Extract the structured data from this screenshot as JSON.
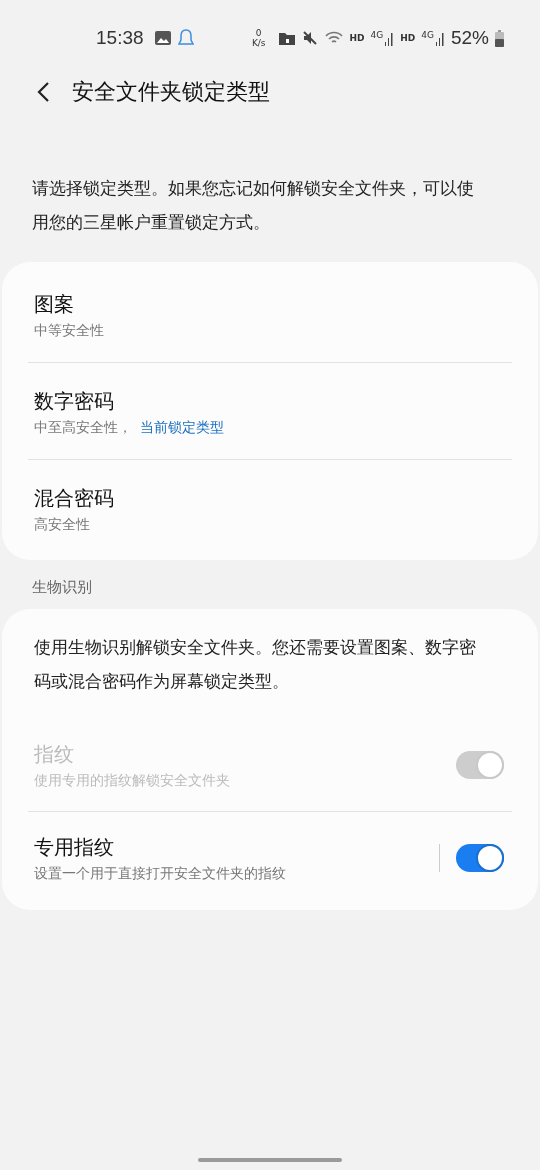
{
  "status_bar": {
    "time": "15:38",
    "net_speed_value": "0",
    "net_speed_unit": "K/s",
    "sim1_hd": "HD",
    "sim1_net": "4G",
    "sim2_hd": "HD",
    "sim2_net": "4G",
    "battery": "52%"
  },
  "header": {
    "title": "安全文件夹锁定类型"
  },
  "description": "请选择锁定类型。如果您忘记如何解锁安全文件夹，可以使用您的三星帐户重置锁定方式。",
  "lock_types": [
    {
      "title": "图案",
      "subtitle": "中等安全性"
    },
    {
      "title": "数字密码",
      "subtitle": "中至高安全性，",
      "current": "当前锁定类型"
    },
    {
      "title": "混合密码",
      "subtitle": "高安全性"
    }
  ],
  "biometrics": {
    "section_label": "生物识别",
    "description": "使用生物识别解锁安全文件夹。您还需要设置图案、数字密码或混合密码作为屏幕锁定类型。",
    "items": [
      {
        "title": "指纹",
        "subtitle": "使用专用的指纹解锁安全文件夹",
        "on": true,
        "disabled": true,
        "divider": false
      },
      {
        "title": "专用指纹",
        "subtitle": "设置一个用于直接打开安全文件夹的指纹",
        "on": true,
        "disabled": false,
        "divider": true
      }
    ]
  }
}
